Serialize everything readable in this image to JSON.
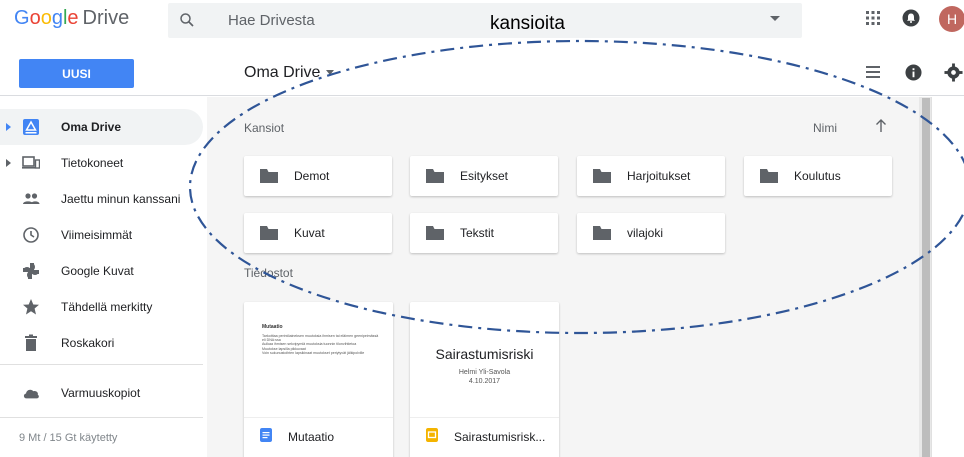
{
  "header": {
    "logo_google": [
      "G",
      "o",
      "o",
      "g",
      "l",
      "e"
    ],
    "logo_drive": "Drive",
    "search_placeholder": "Hae Drivesta",
    "avatar_initial": "H"
  },
  "annotation": {
    "label": "kansioita"
  },
  "toolbar": {
    "new_label": "UUSI",
    "breadcrumb": "Oma Drive"
  },
  "sidebar": {
    "items": [
      {
        "label": "Oma Drive",
        "icon": "drive-icon"
      },
      {
        "label": "Tietokoneet",
        "icon": "computer-icon"
      },
      {
        "label": "Jaettu minun kanssani",
        "icon": "shared-icon"
      },
      {
        "label": "Viimeisimmät",
        "icon": "clock-icon"
      },
      {
        "label": "Google Kuvat",
        "icon": "photos-icon"
      },
      {
        "label": "Tähdellä merkitty",
        "icon": "star-icon"
      },
      {
        "label": "Roskakori",
        "icon": "trash-icon"
      },
      {
        "label": "Varmuuskopiot",
        "icon": "cloud-icon"
      }
    ],
    "storage": "9 Mt / 15 Gt käytetty"
  },
  "main": {
    "folders_title": "Kansiot",
    "sort_label": "Nimi",
    "folders": [
      "Demot",
      "Esitykset",
      "Harjoitukset",
      "Koulutus",
      "Kuvat",
      "Tekstit",
      "vilajoki"
    ],
    "files_title": "Tiedostot",
    "files": [
      {
        "name": "Mutaatio",
        "type": "doc",
        "preview_title": "Mutaatio",
        "preview_bullets": [
          "Tarkoittaa perintöaineksen muutoksia ihmisen tai eläimen geenipeimässä eli DNA:ssa",
          "Aulkaa ihmisen sekvipymiä muutoksia tuonnin tilonvihtietoa",
          "Muutokse lapsilla pikkuvaat",
          "Voin sukunustoihten lapsikinaat muutokset periytyvät jälkipolville"
        ]
      },
      {
        "name": "Sairastumisrisk...",
        "type": "slides",
        "preview_title": "Sairastumisriski",
        "preview_author": "Helmi Yli-Savola",
        "preview_date": "4.10.2017"
      }
    ]
  },
  "colors": {
    "accent": "#4285f4",
    "doc": "#4285f4",
    "slides": "#f4b400",
    "folder": "#5f6368"
  }
}
